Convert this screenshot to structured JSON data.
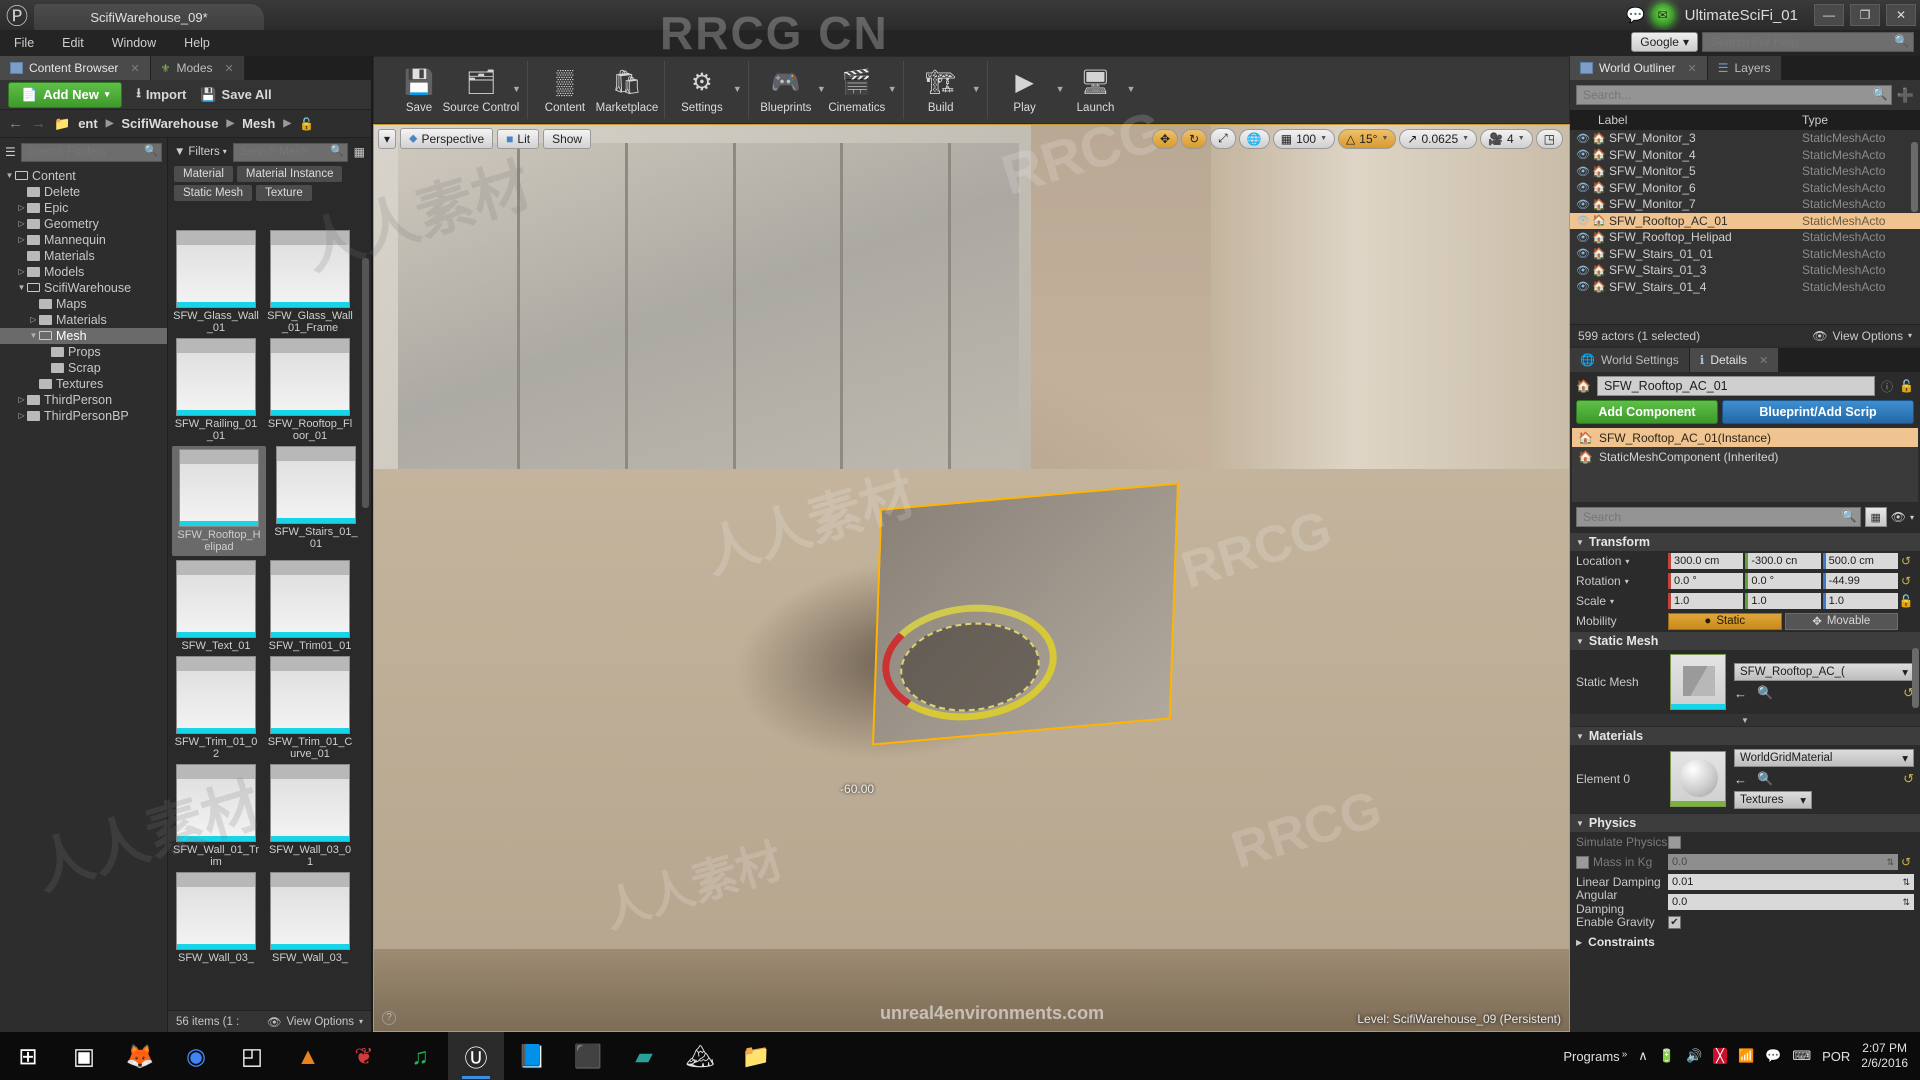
{
  "window": {
    "project_tab": "ScifiWarehouse_09*",
    "app_title": "UltimateSciFi_01",
    "minimize": "—",
    "restore": "❐",
    "close": "✕"
  },
  "menubar": {
    "items": [
      "File",
      "Edit",
      "Window",
      "Help"
    ]
  },
  "help_search": {
    "engine": "Google",
    "placeholder": "Search For Help",
    "icon": "search-icon"
  },
  "left_panel": {
    "tabs": [
      {
        "label": "Content Browser",
        "icon": "grid-icon",
        "active": true
      },
      {
        "label": "Modes",
        "icon": "modes-icon",
        "active": false
      }
    ],
    "toolbar": {
      "add_new": "Add New",
      "import": "Import",
      "save_all": "Save All"
    },
    "breadcrumb": {
      "back": "←",
      "forward": "→",
      "items": [
        "ent",
        "ScifiWarehouse",
        "Mesh"
      ],
      "lock_icon": "lock-icon"
    },
    "folder_search_placeholder": "Search Folders",
    "tree": [
      {
        "label": "Content",
        "depth": 0,
        "twisty": "open",
        "selected": false
      },
      {
        "label": "Delete",
        "depth": 1,
        "twisty": "none",
        "selected": false
      },
      {
        "label": "Epic",
        "depth": 1,
        "twisty": "closed",
        "selected": false
      },
      {
        "label": "Geometry",
        "depth": 1,
        "twisty": "closed",
        "selected": false
      },
      {
        "label": "Mannequin",
        "depth": 1,
        "twisty": "closed",
        "selected": false
      },
      {
        "label": "Materials",
        "depth": 1,
        "twisty": "none",
        "selected": false
      },
      {
        "label": "Models",
        "depth": 1,
        "twisty": "closed",
        "selected": false
      },
      {
        "label": "ScifiWarehouse",
        "depth": 1,
        "twisty": "open",
        "selected": false
      },
      {
        "label": "Maps",
        "depth": 2,
        "twisty": "none",
        "selected": false
      },
      {
        "label": "Materials",
        "depth": 2,
        "twisty": "closed",
        "selected": false
      },
      {
        "label": "Mesh",
        "depth": 2,
        "twisty": "open",
        "selected": true
      },
      {
        "label": "Props",
        "depth": 3,
        "twisty": "none",
        "selected": false
      },
      {
        "label": "Scrap",
        "depth": 3,
        "twisty": "none",
        "selected": false
      },
      {
        "label": "Textures",
        "depth": 2,
        "twisty": "none",
        "selected": false
      },
      {
        "label": "ThirdPerson",
        "depth": 1,
        "twisty": "closed",
        "selected": false
      },
      {
        "label": "ThirdPersonBP",
        "depth": 1,
        "twisty": "closed",
        "selected": false
      }
    ],
    "filters_label": "Filters",
    "asset_search_placeholder": "Search Mesh",
    "filter_chips": [
      "Material",
      "Material Instance",
      "Static Mesh",
      "Texture"
    ],
    "assets": [
      {
        "label": "SFW_Glass_Wall_01",
        "selected": false
      },
      {
        "label": "SFW_Glass_Wall_01_Frame",
        "selected": false
      },
      {
        "label": "SFW_Railing_01_01",
        "selected": false
      },
      {
        "label": "SFW_Rooftop_Floor_01",
        "selected": false
      },
      {
        "label": "SFW_Rooftop_Helipad",
        "selected": true
      },
      {
        "label": "SFW_Stairs_01_01",
        "selected": false
      },
      {
        "label": "SFW_Text_01",
        "selected": false
      },
      {
        "label": "SFW_Trim01_01",
        "selected": false
      },
      {
        "label": "SFW_Trim_01_02",
        "selected": false
      },
      {
        "label": "SFW_Trim_01_Curve_01",
        "selected": false
      },
      {
        "label": "SFW_Wall_01_Trim",
        "selected": false
      },
      {
        "label": "SFW_Wall_03_01",
        "selected": false
      },
      {
        "label": "SFW_Wall_03_",
        "selected": false
      },
      {
        "label": "SFW_Wall_03_",
        "selected": false
      }
    ],
    "status": {
      "items_count": "56 items (1 :",
      "view_options": "View Options"
    }
  },
  "main_toolbar": {
    "groups": [
      {
        "items": [
          {
            "label": "Save",
            "icon": "save-icon",
            "caret": false
          },
          {
            "label": "Source Control",
            "icon": "source-control-icon",
            "caret": true
          }
        ]
      },
      {
        "items": [
          {
            "label": "Content",
            "icon": "content-icon",
            "caret": false
          },
          {
            "label": "Marketplace",
            "icon": "marketplace-icon",
            "caret": false
          }
        ]
      },
      {
        "items": [
          {
            "label": "Settings",
            "icon": "settings-gear-icon",
            "caret": true
          }
        ]
      },
      {
        "items": [
          {
            "label": "Blueprints",
            "icon": "blueprints-icon",
            "caret": true
          },
          {
            "label": "Cinematics",
            "icon": "cinematics-clapper-icon",
            "caret": true
          }
        ]
      },
      {
        "items": [
          {
            "label": "Build",
            "icon": "build-icon",
            "caret": true
          }
        ]
      },
      {
        "items": [
          {
            "label": "Play",
            "icon": "play-icon",
            "caret": true
          },
          {
            "label": "Launch",
            "icon": "launch-icon",
            "caret": true
          }
        ]
      }
    ]
  },
  "viewport": {
    "left_buttons": [
      {
        "label": "Perspective",
        "icon": "camera-icon"
      },
      {
        "label": "Lit",
        "icon": "lit-cube-icon"
      },
      {
        "label": "Show",
        "icon": ""
      }
    ],
    "right_controls": [
      {
        "label": "",
        "icon": "translate-icon",
        "active": true
      },
      {
        "label": "",
        "icon": "rotate-icon",
        "active": true
      },
      {
        "label": "",
        "icon": "scale-icon",
        "active": false
      },
      {
        "label": "",
        "icon": "world-globe-icon",
        "active": false
      },
      {
        "label": "100",
        "icon": "grid-snap-icon",
        "active": false
      },
      {
        "label": "15°",
        "icon": "angle-snap-icon",
        "active": true
      },
      {
        "label": "0.0625",
        "icon": "scale-snap-icon",
        "active": false
      },
      {
        "label": "4",
        "icon": "camera-speed-icon",
        "active": false
      },
      {
        "label": "",
        "icon": "maximize-viewport-icon",
        "active": false
      }
    ],
    "rotation_readout": "-60.00",
    "level_status": "Level:  ScifiWarehouse_09 (Persistent)",
    "help_icon": "question-icon"
  },
  "outliner": {
    "tabs": [
      {
        "label": "World Outliner",
        "icon": "outliner-icon",
        "active": true
      },
      {
        "label": "Layers",
        "icon": "layers-icon",
        "active": false
      }
    ],
    "search_placeholder": "Search...",
    "add_icon": "add-folder-icon",
    "columns": [
      "Label",
      "Type"
    ],
    "rows": [
      {
        "label": "SFW_Monitor_3",
        "type": "StaticMeshActo",
        "selected": false
      },
      {
        "label": "SFW_Monitor_4",
        "type": "StaticMeshActo",
        "selected": false
      },
      {
        "label": "SFW_Monitor_5",
        "type": "StaticMeshActo",
        "selected": false
      },
      {
        "label": "SFW_Monitor_6",
        "type": "StaticMeshActo",
        "selected": false
      },
      {
        "label": "SFW_Monitor_7",
        "type": "StaticMeshActo",
        "selected": false
      },
      {
        "label": "SFW_Rooftop_AC_01",
        "type": "StaticMeshActo",
        "selected": true
      },
      {
        "label": "SFW_Rooftop_Helipad",
        "type": "StaticMeshActo",
        "selected": false
      },
      {
        "label": "SFW_Stairs_01_01",
        "type": "StaticMeshActo",
        "selected": false
      },
      {
        "label": "SFW_Stairs_01_3",
        "type": "StaticMeshActo",
        "selected": false
      },
      {
        "label": "SFW_Stairs_01_4",
        "type": "StaticMeshActo",
        "selected": false
      }
    ],
    "footer": {
      "actor_count": "599 actors (1 selected)",
      "view_options": "View Options"
    }
  },
  "details": {
    "tabs": [
      {
        "label": "World Settings",
        "icon": "world-settings-icon",
        "active": false
      },
      {
        "label": "Details",
        "icon": "details-info-icon",
        "active": true
      }
    ],
    "actor_name": "SFW_Rooftop_AC_01",
    "help_icon": "question-icon",
    "lock_icon": "lock-icon",
    "add_component": "Add Component",
    "blueprint_button": "Blueprint/Add Scrip",
    "components": [
      {
        "label": "SFW_Rooftop_AC_01(Instance)",
        "selected": true
      },
      {
        "label": "StaticMeshComponent (Inherited)",
        "selected": false
      }
    ],
    "search_placeholder": "Search",
    "sections": {
      "transform": {
        "title": "Transform",
        "location": {
          "label": "Location",
          "x": "300.0 cm",
          "y": "-300.0 cn",
          "z": "500.0 cm"
        },
        "rotation": {
          "label": "Rotation",
          "x": "0.0 °",
          "y": "0.0 °",
          "z": "-44.99"
        },
        "scale": {
          "label": "Scale",
          "x": "1.0",
          "y": "1.0",
          "z": "1.0"
        },
        "mobility": {
          "label": "Mobility",
          "static": "Static",
          "movable": "Movable",
          "selected": "Static"
        }
      },
      "static_mesh": {
        "title": "Static Mesh",
        "row_label": "Static Mesh",
        "asset": "SFW_Rooftop_AC_("
      },
      "materials": {
        "title": "Materials",
        "row_label": "Element 0",
        "material": "WorldGridMaterial",
        "textures_dropdown": "Textures"
      },
      "physics": {
        "title": "Physics",
        "rows": [
          {
            "label": "Simulate Physics",
            "value": "",
            "kind": "checkbox",
            "checked": false,
            "dim": true
          },
          {
            "label": "Mass in Kg",
            "value": "0.0",
            "kind": "field",
            "checked": false,
            "dim": true
          },
          {
            "label": "Linear Damping",
            "value": "0.01",
            "kind": "field",
            "checked": false,
            "dim": false
          },
          {
            "label": "Angular Damping",
            "value": "0.0",
            "kind": "field",
            "checked": false,
            "dim": false
          },
          {
            "label": "Enable Gravity",
            "value": "",
            "kind": "checkbox",
            "checked": true,
            "dim": false
          }
        ],
        "constraints": "Constraints"
      }
    }
  },
  "taskbar": {
    "items": [
      {
        "icon": "windows-start-icon",
        "name": "start-button",
        "active": false
      },
      {
        "icon": "task-view-icon",
        "name": "task-view",
        "active": false
      },
      {
        "icon": "firefox-icon",
        "name": "firefox",
        "active": false
      },
      {
        "icon": "chrome-icon",
        "name": "chrome",
        "active": false
      },
      {
        "icon": "epic-games-icon",
        "name": "epic-games",
        "active": false
      },
      {
        "icon": "vlc-icon",
        "name": "vlc",
        "active": false
      },
      {
        "icon": "substance-icon",
        "name": "substance",
        "active": false
      },
      {
        "icon": "spotify-icon",
        "name": "spotify",
        "active": false
      },
      {
        "icon": "unreal-icon",
        "name": "unreal-engine",
        "active": true
      },
      {
        "icon": "book-icon",
        "name": "reader",
        "active": false
      },
      {
        "icon": "terminal-icon",
        "name": "terminal",
        "active": false
      },
      {
        "icon": "krita-icon",
        "name": "krita",
        "active": false
      },
      {
        "icon": "photos-icon",
        "name": "photos",
        "active": false
      },
      {
        "icon": "explorer-icon",
        "name": "file-explorer",
        "active": false
      }
    ],
    "tray": {
      "programs_label": "Programs",
      "overflow": "»",
      "chevron": "∧",
      "icons": [
        "battery-icon",
        "volume-icon",
        "avira-icon",
        "wifi-icon",
        "action-center-icon",
        "keyboard-icon"
      ],
      "language": "POR",
      "time": "2:07 PM",
      "date": "2/6/2016"
    }
  },
  "watermarks": {
    "brand_top": "RRCG CN",
    "site": "unreal4environments.com",
    "cn_text": "人人素材",
    "brand": "RRCG"
  }
}
